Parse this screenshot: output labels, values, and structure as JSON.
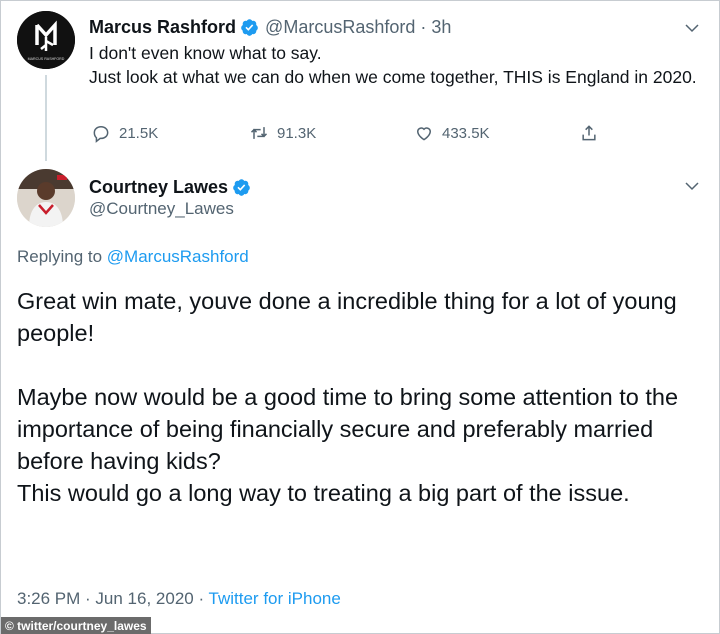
{
  "tweet1": {
    "name": "Marcus Rashford",
    "handle": "@MarcusRashford",
    "separator": "·",
    "time": "3h",
    "text_line1": "I don't even know what to say.",
    "text_line2": "Just look at what we can do when we come together, THIS is England in 2020.",
    "reply_count": "21.5K",
    "retweet_count": "91.3K",
    "like_count": "433.5K",
    "avatar_logo_text": "MARCUS RASHFORD"
  },
  "tweet2": {
    "name": "Courtney Lawes",
    "handle": "@Courtney_Lawes",
    "replying_prefix": "Replying to ",
    "replying_to": "@MarcusRashford",
    "para1": "Great win mate, youve done a incredible thing for a lot of young people!",
    "para2_line1": "Maybe now would be a good time to bring some attention to the importance of being financially secure and preferably married before having kids?",
    "para2_line2": "This would go a long way to treating a big part of the issue.",
    "timestamp": "3:26 PM · Jun 16, 2020 · ",
    "source": "Twitter for iPhone"
  },
  "credit": "© twitter/courtney_lawes",
  "colors": {
    "accent": "#1d9bf0",
    "muted": "#536471",
    "text": "#0f1419"
  },
  "icons": [
    "verified-badge-icon",
    "chevron-down-icon",
    "reply-icon",
    "retweet-icon",
    "like-icon",
    "share-icon"
  ]
}
